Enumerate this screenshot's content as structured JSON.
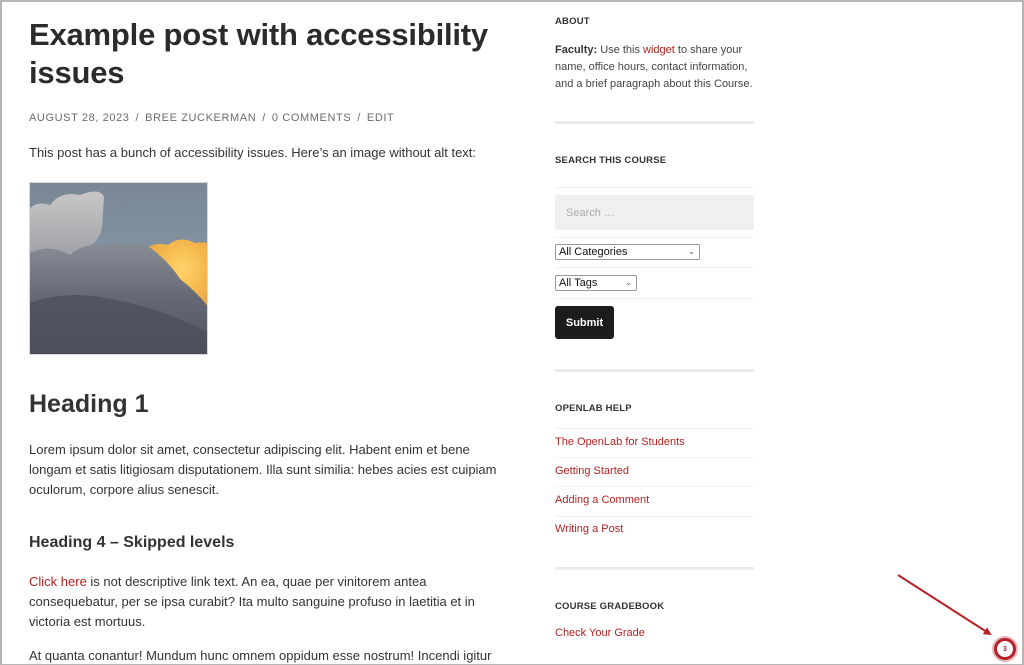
{
  "post": {
    "title": "Example post with accessibility issues",
    "meta": {
      "date": "AUGUST 28, 2023",
      "author": "BREE ZUCKERMAN",
      "comments": "0 COMMENTS",
      "edit": "EDIT",
      "separator": "/"
    },
    "intro": "This post has a bunch of accessibility issues. Here’s an image without alt text:",
    "image": {
      "description": "sky-with-clouds-photo",
      "colors": {
        "sky": "#7f8d9b",
        "cloud_dark": "#5a5f69",
        "cloud_light": "#b8b8bc",
        "cloud_lit": "#f2b347"
      }
    },
    "heading1": "Heading 1",
    "paragraph1": "Lorem ipsum dolor sit amet, consectetur adipiscing elit. Habent enim et bene longam et satis litigiosam disputationem. Illa sunt similia: hebes acies est cuipiam oculorum, corpore alius senescit.",
    "heading4": "Heading 4 – Skipped levels",
    "paragraph2_link": "Click here",
    "paragraph2_rest": " is not descriptive link text. An ea, quae per vinitorem antea consequebatur, per se ipsa curabit? Ita multo sanguine profuso in laetitia et in victoria est mortuus.",
    "paragraph3": "At quanta conantur! Mundum hunc omnem oppidum esse nostrum! Incendi igitur"
  },
  "sidebar": {
    "about": {
      "title": "ABOUT",
      "label": "Faculty:",
      "text_before": " Use this ",
      "link": "widget",
      "text_after": " to share your name, office hours, contact information, and a brief paragraph about this Course."
    },
    "search": {
      "title": "SEARCH THIS COURSE",
      "placeholder": "Search …",
      "categories_selected": "All Categories",
      "tags_selected": "All Tags",
      "submit_label": "Submit"
    },
    "help": {
      "title": "OPENLAB HELP",
      "links": [
        "The OpenLab for Students",
        "Getting Started",
        "Adding a Comment",
        "Writing a Post"
      ]
    },
    "gradebook": {
      "title": "COURSE GRADEBOOK",
      "link": "Check Your Grade"
    }
  },
  "annotation": {
    "badge_count": "3",
    "color": "#b4232a"
  },
  "colors": {
    "link": "#b22222",
    "text": "#333333",
    "button_bg": "#1c1c1c"
  }
}
